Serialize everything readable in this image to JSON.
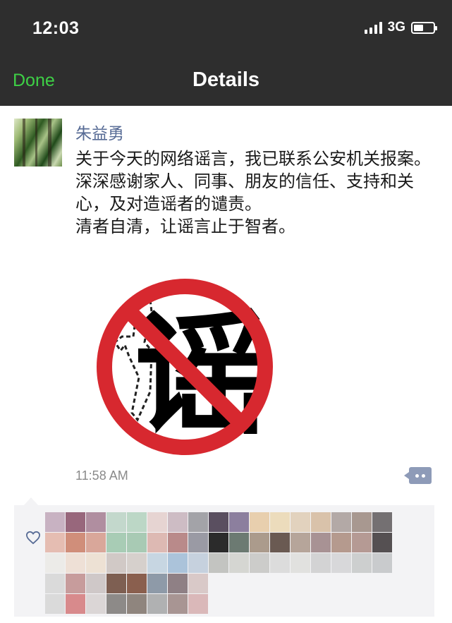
{
  "status_bar": {
    "time": "12:03",
    "network": "3G",
    "signal_bars": 4,
    "battery_level": 0.5
  },
  "nav": {
    "back_label": "Done",
    "title": "Details",
    "back_color": "#3ed046"
  },
  "post": {
    "author": "朱益勇",
    "text": "关于今天的网络谣言，我已联系公安机关报案。\n深深感谢家人、同事、朋友的信任、支持和关心，及对造谣者的谴责。\n清者自清，让谣言止于智者。",
    "image_glyph": "谣",
    "image_description_icon": "no-rumor-icon",
    "timestamp": "11:58 AM",
    "comment_icon": "comment-dots-icon"
  },
  "likes": {
    "icon": "heart-outline-icon",
    "avatar_colors": [
      "#c8b2c2",
      "#98677c",
      "#b08ea0",
      "#c3d8cc",
      "#bcd7c6",
      "#e6d4d2",
      "#cdbcc4",
      "#a3a3a8",
      "#5a4f60",
      "#8c7f9e",
      "#e8cfae",
      "#ecdcbc",
      "#e2d2be",
      "#d9c2aa",
      "#b3a9a6",
      "#a89890",
      "#747072",
      "#e5bdb2",
      "#d08e7a",
      "#d9a79a",
      "#a8ccb5",
      "#a8cab4",
      "#ddb9b3",
      "#b98a8a",
      "#9a9aa4",
      "#2b2b2b",
      "#6c7a72",
      "#ab9b8c",
      "#6a5a52",
      "#b6a59a",
      "#a89294",
      "#b59a8e",
      "#b59a94",
      "#555052",
      "#ecebe8",
      "#eee0d6",
      "#ede1d4",
      "#d1c9c6",
      "#d6d0cc",
      "#c7d6e2",
      "#abc3da",
      "#c6d1de",
      "#c3c4c1",
      "#d5d6d2",
      "#ccccca",
      "#dcdcdc",
      "#e1e1df",
      "#d3d3d4",
      "#d8d8da",
      "#cdcfcf",
      "#c9cbcd",
      "#dadada",
      "#c79c9c",
      "#cfc8c8",
      "#7e5f52",
      "#8a5f4e",
      "#8e9aa8",
      "#8f8085",
      "#d9c9c8",
      "#dadada",
      "#d88a8c",
      "#dbd6d6",
      "#8d8a88",
      "#8f857e",
      "#b0b1b2",
      "#a89593",
      "#dab8b9"
    ]
  }
}
